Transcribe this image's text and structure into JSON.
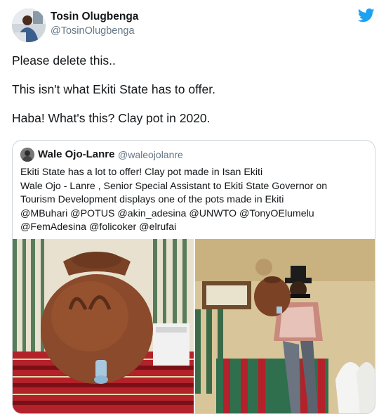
{
  "tweet": {
    "author_name": "Tosin Olugbenga",
    "author_handle": "@TosinOlugbenga",
    "lines": [
      "Please delete this..",
      "This isn't what Ekiti State has to offer.",
      "Haba! What's this? Clay pot in 2020."
    ],
    "brand_color": "#1da1f2",
    "icons": {
      "logo": "twitter-bird-icon"
    }
  },
  "quote": {
    "author_name": "Wale Ojo-Lanre",
    "author_handle": "@waleojolanre",
    "lines": [
      "Ekiti State has a lot to offer! Clay pot made in Isan Ekiti",
      "Wale Ojo - Lanre , Senior Special Assistant to Ekiti State Governor on",
      "Tourism Development displays one of the pots made in Ekiti",
      "@MBuhari @POTUS @akin_adesina @UNWTO @TonyOElumelu",
      "@FemAdesina @folicoker @elrufai"
    ]
  }
}
